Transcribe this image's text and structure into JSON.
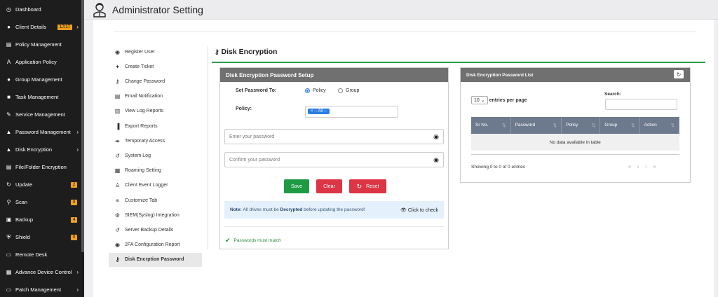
{
  "header": {
    "title": "Administrator Setting"
  },
  "sidebar": {
    "items": [
      {
        "label": "Dashboard",
        "icon": "dashboard-icon",
        "glyph": "◷"
      },
      {
        "label": "Client Details",
        "icon": "users-icon",
        "glyph": "●",
        "badge": "17/17",
        "chevron": "›"
      },
      {
        "label": "Policy Management",
        "icon": "file-icon",
        "glyph": "▤"
      },
      {
        "label": "Application Policy",
        "icon": "app-icon",
        "glyph": "A"
      },
      {
        "label": "Group Management",
        "icon": "group-icon",
        "glyph": "●"
      },
      {
        "label": "Task Management",
        "icon": "task-icon",
        "glyph": "■"
      },
      {
        "label": "Service Management",
        "icon": "wrench-icon",
        "glyph": "✎"
      },
      {
        "label": "Password Management",
        "icon": "lock-icon",
        "glyph": "▲",
        "chevron": "›"
      },
      {
        "label": "Disk Encryption",
        "icon": "lock-icon",
        "glyph": "▲",
        "chevron": "›"
      },
      {
        "label": "File/Folder Encryption",
        "icon": "file-lock-icon",
        "glyph": "▤"
      },
      {
        "label": "Update",
        "icon": "update-icon",
        "glyph": "↻",
        "badge": "2"
      },
      {
        "label": "Scan",
        "icon": "search-icon",
        "glyph": "⚲",
        "badge": "0"
      },
      {
        "label": "Backup",
        "icon": "backup-icon",
        "glyph": "▣",
        "badge": "4"
      },
      {
        "label": "Shield",
        "icon": "shield-icon",
        "glyph": "⛨",
        "badge": "0"
      },
      {
        "label": "Remote Desk",
        "icon": "monitor-icon",
        "glyph": "▭"
      },
      {
        "label": "Advance Device Control",
        "icon": "device-icon",
        "glyph": "▦",
        "chevron": "›"
      },
      {
        "label": "Patch Management",
        "icon": "monitor-icon",
        "glyph": "▭",
        "chevron": "›"
      }
    ]
  },
  "menu": {
    "items": [
      {
        "label": "Register User",
        "icon": "user-circle-icon",
        "glyph": "◉"
      },
      {
        "label": "Create Ticket",
        "icon": "ticket-icon",
        "glyph": "✦"
      },
      {
        "label": "Change Password",
        "icon": "key-icon",
        "glyph": "⚷"
      },
      {
        "label": "Email Notification",
        "icon": "email-icon",
        "glyph": "▤"
      },
      {
        "label": "View Log Reports",
        "icon": "log-report-icon",
        "glyph": "▥"
      },
      {
        "label": "Export Reports",
        "icon": "export-icon",
        "glyph": "▐"
      },
      {
        "label": "Temporary Access",
        "icon": "usb-icon",
        "glyph": "⇹"
      },
      {
        "label": "System Log",
        "icon": "history-icon",
        "glyph": "↺"
      },
      {
        "label": "Roaming Setting",
        "icon": "table-icon",
        "glyph": "▦"
      },
      {
        "label": "Client Event Logger",
        "icon": "person-icon",
        "glyph": "♙"
      },
      {
        "label": "Customize Tab",
        "icon": "list-icon",
        "glyph": "≡"
      },
      {
        "label": "SIEM(Syslog) Integration",
        "icon": "cogs-icon",
        "glyph": "⚙"
      },
      {
        "label": "Server Backup Details",
        "icon": "history-icon",
        "glyph": "↺"
      },
      {
        "label": "2FA Configuration Report",
        "icon": "user-circle-icon",
        "glyph": "◉"
      },
      {
        "label": "Disk Encrption Password",
        "icon": "key-icon",
        "glyph": "⚷",
        "active": true
      }
    ]
  },
  "section": {
    "title": "Disk Encryption"
  },
  "setup": {
    "title": "Disk Encryption Password Setup",
    "set_password_label": "Set Password To:",
    "radio_policy": "Policy",
    "radio_group": "Group",
    "policy_label": "Policy:",
    "policy_chip": "× -- All --",
    "password_placeholder": "Enter your password",
    "confirm_placeholder": "Confirm your password",
    "save": "Save",
    "clear": "Clear",
    "reset": "Reset",
    "note_prefix": "Note:",
    "note_text1": "All drives must be",
    "note_bold": "Decrypted",
    "note_text2": "before updating the password!",
    "click_to_check": "Click to check",
    "validation": "Passwords must match",
    "colors": {
      "save": "#1f9a44",
      "clear": "#dc3545",
      "reset": "#dc3545"
    }
  },
  "list": {
    "title": "Disk Encryption Password List",
    "entries_value": "10",
    "entries_label": "entries per page",
    "search_label": "Search:",
    "columns": [
      "Sr No.",
      "Password",
      "Policy",
      "Group",
      "Action"
    ],
    "empty": "No data available in table",
    "info": "Showing 0 to 0 of 0 entries",
    "pager": "«‹›»"
  }
}
